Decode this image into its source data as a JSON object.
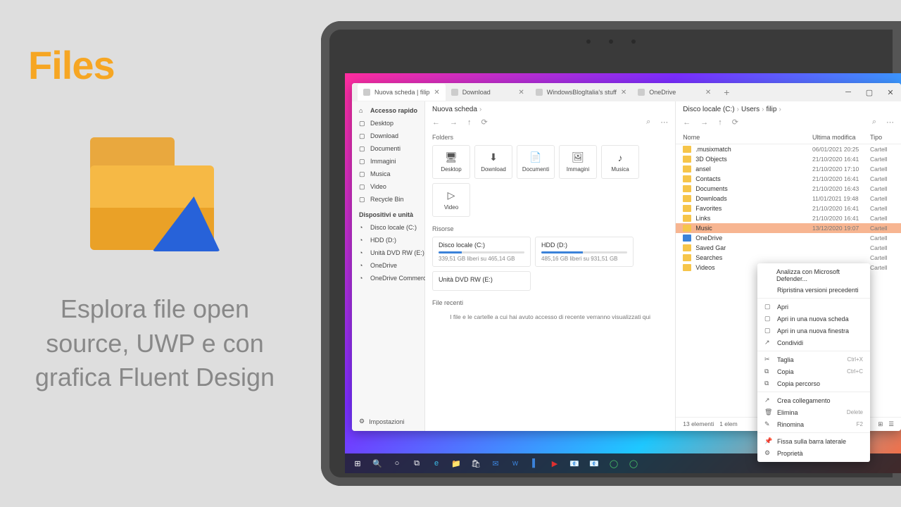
{
  "promo": {
    "title": "Files",
    "tagline": "Esplora file open source, UWP e con grafica Fluent Design"
  },
  "tabs": [
    {
      "label": "Nuova scheda | filip",
      "active": true
    },
    {
      "label": "Download",
      "active": false
    },
    {
      "label": "WindowsBlogItalia's stuff",
      "active": false
    },
    {
      "label": "OneDrive",
      "active": false
    }
  ],
  "sidebar": {
    "quick": "Accesso rapido",
    "items": [
      "Desktop",
      "Download",
      "Documenti",
      "Immagini",
      "Musica",
      "Video",
      "Recycle Bin"
    ],
    "devices_header": "Dispositivi e unità",
    "devices": [
      "Disco locale (C:)",
      "HDD (D:)",
      "Unità DVD RW (E:)",
      "OneDrive",
      "OneDrive Commercial"
    ],
    "settings": "Impostazioni"
  },
  "paneA": {
    "crumb": "Nuova scheda",
    "folders_header": "Folders",
    "tiles": [
      "Desktop",
      "Download",
      "Documenti",
      "Immagini",
      "Musica",
      "Video"
    ],
    "resources_header": "Risorse",
    "drives": [
      {
        "name": "Disco locale (C:)",
        "free": "339,51 GB liberi su 465,14 GB",
        "pct": 27
      },
      {
        "name": "HDD (D:)",
        "free": "485,16 GB liberi su 931,51 GB",
        "pct": 48
      },
      {
        "name": "Unità DVD RW (E:)",
        "free": "",
        "pct": 0
      }
    ],
    "recent_header": "File recenti",
    "recent_empty": "I file e le cartelle a cui hai avuto accesso di recente verranno visualizzati qui"
  },
  "paneB": {
    "crumb": [
      "Disco locale (C:)",
      "Users",
      "filip"
    ],
    "cols": {
      "name": "Nome",
      "date": "Ultima modifica",
      "type": "Tipo"
    },
    "rows": [
      {
        "n": ".musixmatch",
        "d": "06/01/2021 20:25",
        "t": "Cartell"
      },
      {
        "n": "3D Objects",
        "d": "21/10/2020 16:41",
        "t": "Cartell"
      },
      {
        "n": "ansel",
        "d": "21/10/2020 17:10",
        "t": "Cartell"
      },
      {
        "n": "Contacts",
        "d": "21/10/2020 16:41",
        "t": "Cartell"
      },
      {
        "n": "Documents",
        "d": "21/10/2020 16:43",
        "t": "Cartell"
      },
      {
        "n": "Downloads",
        "d": "11/01/2021 19:48",
        "t": "Cartell"
      },
      {
        "n": "Favorites",
        "d": "21/10/2020 16:41",
        "t": "Cartell"
      },
      {
        "n": "Links",
        "d": "21/10/2020 16:41",
        "t": "Cartell"
      },
      {
        "n": "Music",
        "d": "13/12/2020 19:07",
        "t": "Cartell",
        "sel": true
      },
      {
        "n": "OneDrive",
        "d": "",
        "t": "Cartell",
        "blue": true
      },
      {
        "n": "Saved Gar",
        "d": "",
        "t": "Cartell"
      },
      {
        "n": "Searches",
        "d": "",
        "t": "Cartell"
      },
      {
        "n": "Videos",
        "d": "",
        "t": "Cartell"
      }
    ],
    "status": {
      "total": "13 elementi",
      "sel": "1 elem"
    }
  },
  "ctx": [
    {
      "label": "Analizza con Microsoft Defender...",
      "ico": ""
    },
    {
      "label": "Ripristina versioni precedenti",
      "ico": ""
    },
    {
      "sep": true
    },
    {
      "label": "Apri",
      "ico": "▢"
    },
    {
      "label": "Apri in una nuova scheda",
      "ico": "▢"
    },
    {
      "label": "Apri in una nuova finestra",
      "ico": "▢"
    },
    {
      "label": "Condividi",
      "ico": "↗"
    },
    {
      "sep": true
    },
    {
      "label": "Taglia",
      "ico": "✂",
      "kbd": "Ctrl+X"
    },
    {
      "label": "Copia",
      "ico": "⧉",
      "kbd": "Ctrl+C"
    },
    {
      "label": "Copia percorso",
      "ico": "⧉"
    },
    {
      "sep": true
    },
    {
      "label": "Crea collegamento",
      "ico": "↗"
    },
    {
      "label": "Elimina",
      "ico": "🗑",
      "kbd": "Delete"
    },
    {
      "label": "Rinomina",
      "ico": "✎",
      "kbd": "F2"
    },
    {
      "sep": true
    },
    {
      "label": "Fissa sulla barra laterale",
      "ico": "📌"
    },
    {
      "label": "Proprietà",
      "ico": "⚙"
    }
  ],
  "taskbar": [
    "⊞",
    "🔍",
    "○",
    "⧉",
    "e",
    "📁",
    "🛍",
    "✉",
    "w",
    "▌",
    "▶",
    "📧",
    "📧",
    "◯",
    "◯"
  ]
}
